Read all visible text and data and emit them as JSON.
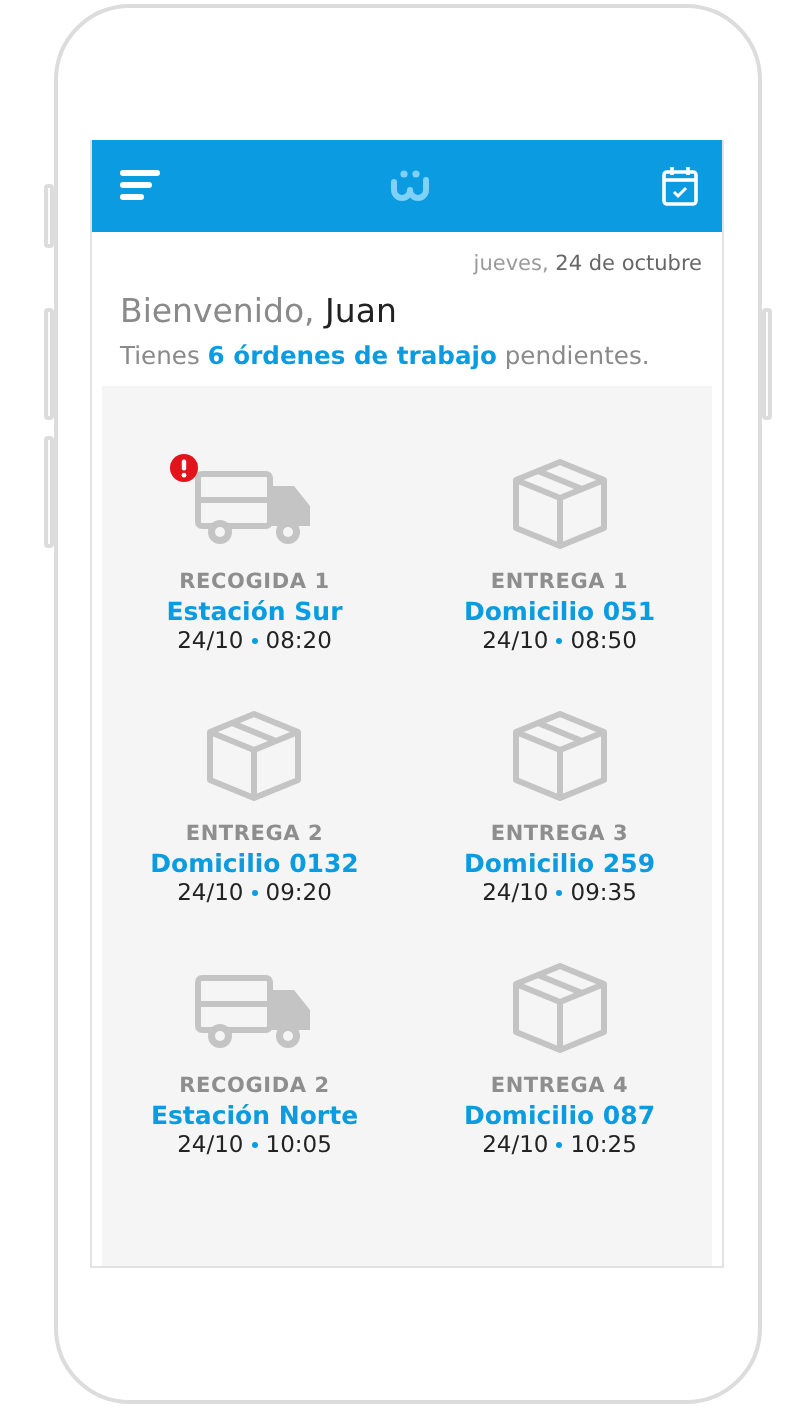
{
  "date": "jueves, **24 de octubre**",
  "greeting": "Bienvenido, **Juan**",
  "summary": "Tienes **6 órdenes de trabajo** pendientes.",
  "orders": [
    {
      "kind": "truck",
      "alert": true,
      "type": "RECOGIDA 1",
      "place": "Estación Sur",
      "date": "24/10",
      "time": "08:20"
    },
    {
      "kind": "box",
      "alert": false,
      "type": "ENTREGA 1",
      "place": "Domicilio 051",
      "date": "24/10",
      "time": "08:50"
    },
    {
      "kind": "box",
      "alert": false,
      "type": "ENTREGA 2",
      "place": "Domicilio 0132",
      "date": "24/10",
      "time": "09:20"
    },
    {
      "kind": "box",
      "alert": false,
      "type": "ENTREGA 3",
      "place": "Domicilio 259",
      "date": "24/10",
      "time": "09:35"
    },
    {
      "kind": "truck",
      "alert": false,
      "type": "RECOGIDA 2",
      "place": "Estación Norte",
      "date": "24/10",
      "time": "10:05"
    },
    {
      "kind": "box",
      "alert": false,
      "type": "ENTREGA 4",
      "place": "Domicilio 087",
      "date": "24/10",
      "time": "10:25"
    }
  ]
}
